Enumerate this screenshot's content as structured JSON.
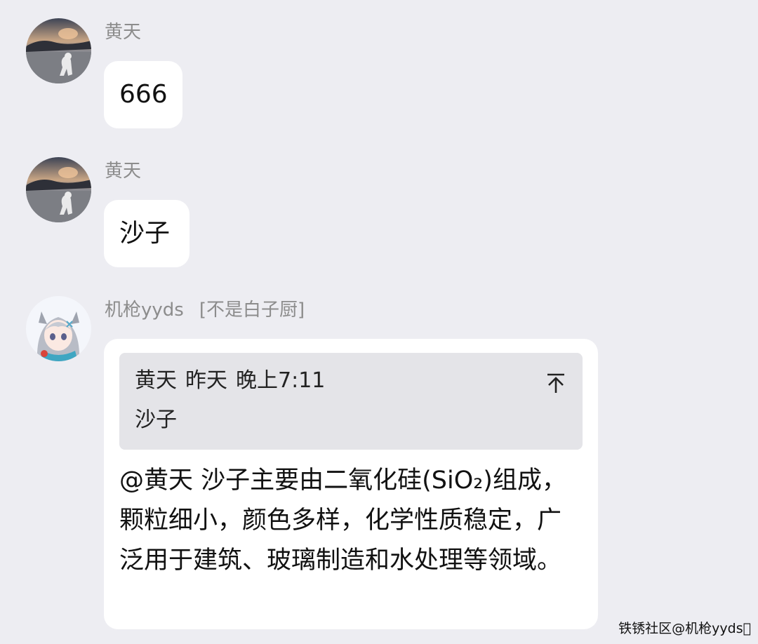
{
  "messages": [
    {
      "sender": "黄天",
      "text": "666"
    },
    {
      "sender": "黄天",
      "text": "沙子"
    },
    {
      "sender": "机枪yyds",
      "title": "[不是白子厨]",
      "quote": {
        "author": "黄天",
        "day": "昨天",
        "time": "晚上7:11",
        "text": "沙子"
      },
      "text": "@黄天 沙子主要由二氧化硅(SiO₂)组成，颗粒细小，颜色多样，化学性质稳定，广泛用于建筑、玻璃制造和水处理等领域。"
    }
  ],
  "watermark": "铁锈社区@机枪yyds⃣",
  "colors": {
    "background": "#ededf2",
    "bubble": "#ffffff",
    "quote_background": "#e4e4e8",
    "sender_name": "#8c8c8c"
  },
  "icons": {
    "jump_to_quote": "arrow-up-to-top-icon"
  }
}
